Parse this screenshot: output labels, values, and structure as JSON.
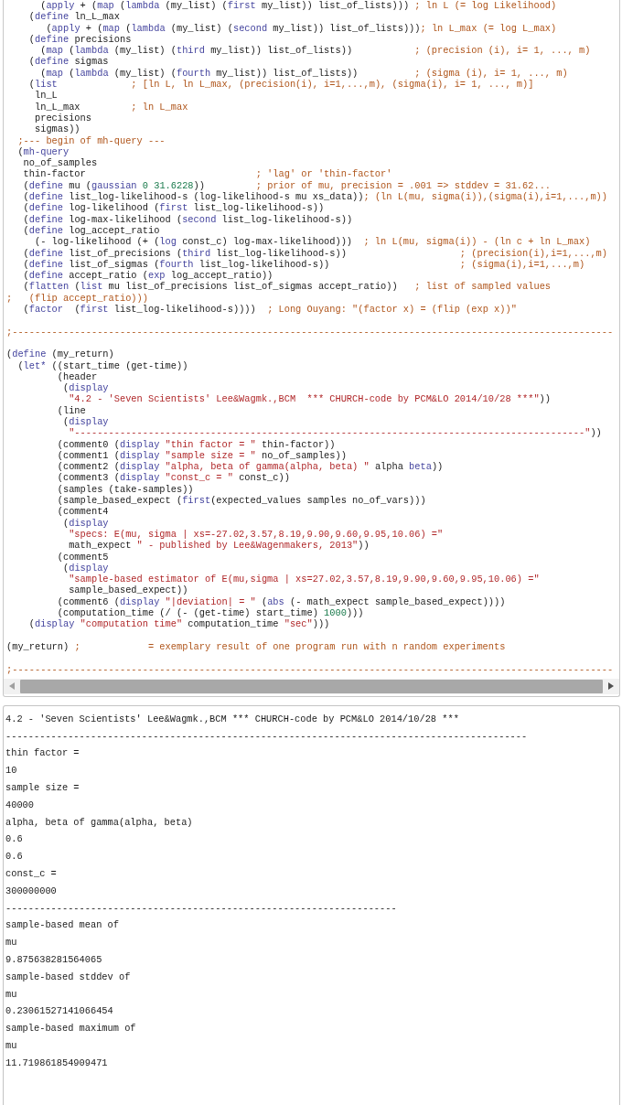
{
  "editor": {
    "lines": [
      {
        "kind": "code",
        "tokens": [
          {
            "kind": "plain",
            "text": "      ("
          },
          {
            "kind": "keyword",
            "text": "apply"
          },
          {
            "kind": "plain",
            "text": " + ("
          },
          {
            "kind": "keyword",
            "text": "map"
          },
          {
            "kind": "plain",
            "text": " ("
          },
          {
            "kind": "keyword",
            "text": "lambda"
          },
          {
            "kind": "plain",
            "text": " (my_list) ("
          },
          {
            "kind": "keyword",
            "text": "first"
          },
          {
            "kind": "plain",
            "text": " my_list)) list_of_lists))) "
          },
          {
            "kind": "comment",
            "text": "; ln L (= log Likelihood)"
          }
        ]
      },
      {
        "kind": "code",
        "tokens": [
          {
            "kind": "plain",
            "text": "    ("
          },
          {
            "kind": "keyword",
            "text": "define"
          },
          {
            "kind": "plain",
            "text": " ln_L_max"
          }
        ]
      },
      {
        "kind": "code",
        "tokens": [
          {
            "kind": "plain",
            "text": "       ("
          },
          {
            "kind": "keyword",
            "text": "apply"
          },
          {
            "kind": "plain",
            "text": " + ("
          },
          {
            "kind": "keyword",
            "text": "map"
          },
          {
            "kind": "plain",
            "text": " ("
          },
          {
            "kind": "keyword",
            "text": "lambda"
          },
          {
            "kind": "plain",
            "text": " (my_list) ("
          },
          {
            "kind": "keyword",
            "text": "second"
          },
          {
            "kind": "plain",
            "text": " my_list)) list_of_lists)))"
          },
          {
            "kind": "comment",
            "text": "; ln L_max (= log L_max)"
          }
        ]
      },
      {
        "kind": "code",
        "tokens": [
          {
            "kind": "plain",
            "text": "    ("
          },
          {
            "kind": "keyword",
            "text": "define"
          },
          {
            "kind": "plain",
            "text": " precisions"
          }
        ]
      },
      {
        "kind": "code",
        "tokens": [
          {
            "kind": "plain",
            "text": "      ("
          },
          {
            "kind": "keyword",
            "text": "map"
          },
          {
            "kind": "plain",
            "text": " ("
          },
          {
            "kind": "keyword",
            "text": "lambda"
          },
          {
            "kind": "plain",
            "text": " (my_list) ("
          },
          {
            "kind": "keyword",
            "text": "third"
          },
          {
            "kind": "plain",
            "text": " my_list)) list_of_lists))           "
          },
          {
            "kind": "comment",
            "text": "; (precision (i), i= 1, ..., m)"
          }
        ]
      },
      {
        "kind": "code",
        "tokens": [
          {
            "kind": "plain",
            "text": "    ("
          },
          {
            "kind": "keyword",
            "text": "define"
          },
          {
            "kind": "plain",
            "text": " sigmas"
          }
        ]
      },
      {
        "kind": "code",
        "tokens": [
          {
            "kind": "plain",
            "text": "      ("
          },
          {
            "kind": "keyword",
            "text": "map"
          },
          {
            "kind": "plain",
            "text": " ("
          },
          {
            "kind": "keyword",
            "text": "lambda"
          },
          {
            "kind": "plain",
            "text": " (my_list) ("
          },
          {
            "kind": "keyword",
            "text": "fourth"
          },
          {
            "kind": "plain",
            "text": " my_list)) list_of_lists))          "
          },
          {
            "kind": "comment",
            "text": "; (sigma (i), i= 1, ..., m)"
          }
        ]
      },
      {
        "kind": "code",
        "tokens": [
          {
            "kind": "plain",
            "text": "    ("
          },
          {
            "kind": "keyword",
            "text": "list"
          },
          {
            "kind": "comment",
            "text": "             ; [ln L, ln L_max, (precision(i), i=1,...,m), (sigma(i), i= 1, ..., m)]"
          }
        ]
      },
      {
        "kind": "code",
        "tokens": [
          {
            "kind": "plain",
            "text": "     ln_L"
          }
        ]
      },
      {
        "kind": "code",
        "tokens": [
          {
            "kind": "plain",
            "text": "     ln_L_max         "
          },
          {
            "kind": "comment",
            "text": "; ln L_max"
          }
        ]
      },
      {
        "kind": "code",
        "tokens": [
          {
            "kind": "plain",
            "text": "     precisions"
          }
        ]
      },
      {
        "kind": "code",
        "tokens": [
          {
            "kind": "plain",
            "text": "     sigmas))"
          }
        ]
      },
      {
        "kind": "code",
        "tokens": [
          {
            "kind": "comment",
            "text": "  ;--- begin of mh-query ---"
          }
        ]
      },
      {
        "kind": "code",
        "tokens": [
          {
            "kind": "plain",
            "text": "  ("
          },
          {
            "kind": "keyword",
            "text": "mh-query"
          }
        ]
      },
      {
        "kind": "code",
        "tokens": [
          {
            "kind": "plain",
            "text": "   no_of_samples"
          }
        ]
      },
      {
        "kind": "code",
        "tokens": [
          {
            "kind": "plain",
            "text": "   thin-factor                              "
          },
          {
            "kind": "comment",
            "text": "; 'lag' or 'thin-factor'"
          }
        ]
      },
      {
        "kind": "code",
        "tokens": [
          {
            "kind": "plain",
            "text": "   ("
          },
          {
            "kind": "keyword",
            "text": "define"
          },
          {
            "kind": "plain",
            "text": " mu ("
          },
          {
            "kind": "keyword",
            "text": "gaussian"
          },
          {
            "kind": "number",
            "text": " 0"
          },
          {
            "kind": "number",
            "text": " 31.6228"
          },
          {
            "kind": "plain",
            "text": "))         "
          },
          {
            "kind": "comment",
            "text": "; prior of mu, precision = .001 => stddev = 31.62..."
          }
        ]
      },
      {
        "kind": "code",
        "tokens": [
          {
            "kind": "plain",
            "text": "   ("
          },
          {
            "kind": "keyword",
            "text": "define"
          },
          {
            "kind": "plain",
            "text": " list_log-likelihood-s (log-likelihood-s mu xs_data))"
          },
          {
            "kind": "comment",
            "text": "; (ln L(mu, sigma(i)),(sigma(i),i=1,...,m))"
          }
        ]
      },
      {
        "kind": "code",
        "tokens": [
          {
            "kind": "plain",
            "text": "   ("
          },
          {
            "kind": "keyword",
            "text": "define"
          },
          {
            "kind": "plain",
            "text": " log-likelihood ("
          },
          {
            "kind": "keyword",
            "text": "first"
          },
          {
            "kind": "plain",
            "text": " list_log-likelihood-s))"
          }
        ]
      },
      {
        "kind": "code",
        "tokens": [
          {
            "kind": "plain",
            "text": "   ("
          },
          {
            "kind": "keyword",
            "text": "define"
          },
          {
            "kind": "plain",
            "text": " log-max-likelihood ("
          },
          {
            "kind": "keyword",
            "text": "second"
          },
          {
            "kind": "plain",
            "text": " list_log-likelihood-s))"
          }
        ]
      },
      {
        "kind": "code",
        "tokens": [
          {
            "kind": "plain",
            "text": "   ("
          },
          {
            "kind": "keyword",
            "text": "define"
          },
          {
            "kind": "plain",
            "text": " log_accept_ratio"
          }
        ]
      },
      {
        "kind": "code",
        "tokens": [
          {
            "kind": "plain",
            "text": "     (- log-likelihood (+ ("
          },
          {
            "kind": "keyword",
            "text": "log"
          },
          {
            "kind": "plain",
            "text": " const_c) log-max-likelihood)))  "
          },
          {
            "kind": "comment",
            "text": "; ln L(mu, sigma(i)) - (ln c + ln L_max)"
          }
        ]
      },
      {
        "kind": "code",
        "tokens": [
          {
            "kind": "plain",
            "text": "   ("
          },
          {
            "kind": "keyword",
            "text": "define"
          },
          {
            "kind": "plain",
            "text": " list_of_precisions ("
          },
          {
            "kind": "keyword",
            "text": "third"
          },
          {
            "kind": "plain",
            "text": " list_log-likelihood-s))                    "
          },
          {
            "kind": "comment",
            "text": "; (precision(i),i=1,...,m)"
          }
        ]
      },
      {
        "kind": "code",
        "tokens": [
          {
            "kind": "plain",
            "text": "   ("
          },
          {
            "kind": "keyword",
            "text": "define"
          },
          {
            "kind": "plain",
            "text": " list_of_sigmas ("
          },
          {
            "kind": "keyword",
            "text": "fourth"
          },
          {
            "kind": "plain",
            "text": " list_log-likelihood-s))                       "
          },
          {
            "kind": "comment",
            "text": "; (sigma(i),i=1,...,m)"
          }
        ]
      },
      {
        "kind": "code",
        "tokens": [
          {
            "kind": "plain",
            "text": "   ("
          },
          {
            "kind": "keyword",
            "text": "define"
          },
          {
            "kind": "plain",
            "text": " accept_ratio ("
          },
          {
            "kind": "keyword",
            "text": "exp"
          },
          {
            "kind": "plain",
            "text": " log_accept_ratio))"
          }
        ]
      },
      {
        "kind": "code",
        "tokens": [
          {
            "kind": "plain",
            "text": "   ("
          },
          {
            "kind": "keyword",
            "text": "flatten"
          },
          {
            "kind": "plain",
            "text": " ("
          },
          {
            "kind": "keyword",
            "text": "list"
          },
          {
            "kind": "plain",
            "text": " mu list_of_precisions list_of_sigmas accept_ratio))   "
          },
          {
            "kind": "comment",
            "text": "; list of sampled values"
          }
        ]
      },
      {
        "kind": "code",
        "tokens": [
          {
            "kind": "comment",
            "text": ";   (flip accept_ratio)))"
          }
        ]
      },
      {
        "kind": "code",
        "tokens": [
          {
            "kind": "plain",
            "text": "   ("
          },
          {
            "kind": "keyword",
            "text": "factor"
          },
          {
            "kind": "plain",
            "text": "  ("
          },
          {
            "kind": "keyword",
            "text": "first"
          },
          {
            "kind": "plain",
            "text": " list_log-likelihood-s))))  "
          },
          {
            "kind": "comment",
            "text": "; Long Ouyang: \"(factor x) = (flip (exp x))\""
          }
        ]
      },
      {
        "kind": "blank"
      },
      {
        "kind": "code",
        "tokens": [
          {
            "kind": "comment",
            "text": ";----------------------------------------------------------------------------------------------------------"
          }
        ]
      },
      {
        "kind": "blank"
      },
      {
        "kind": "code",
        "tokens": [
          {
            "kind": "plain",
            "text": "("
          },
          {
            "kind": "keyword",
            "text": "define"
          },
          {
            "kind": "plain",
            "text": " (my_return)"
          }
        ]
      },
      {
        "kind": "code",
        "tokens": [
          {
            "kind": "plain",
            "text": "  ("
          },
          {
            "kind": "keyword",
            "text": "let*"
          },
          {
            "kind": "plain",
            "text": " ((start_time (get-time))"
          }
        ]
      },
      {
        "kind": "code",
        "tokens": [
          {
            "kind": "plain",
            "text": "         (header"
          }
        ]
      },
      {
        "kind": "code",
        "tokens": [
          {
            "kind": "plain",
            "text": "          ("
          },
          {
            "kind": "keyword",
            "text": "display"
          }
        ]
      },
      {
        "kind": "code",
        "tokens": [
          {
            "kind": "string",
            "text": "           \"4.2 - 'Seven Scientists' Lee&Wagmk.,BCM  *** CHURCH-code by PCM&LO 2014/10/28 ***\""
          },
          {
            "kind": "plain",
            "text": "))"
          }
        ]
      },
      {
        "kind": "code",
        "tokens": [
          {
            "kind": "plain",
            "text": "         (line"
          }
        ]
      },
      {
        "kind": "code",
        "tokens": [
          {
            "kind": "plain",
            "text": "          ("
          },
          {
            "kind": "keyword",
            "text": "display"
          }
        ]
      },
      {
        "kind": "code",
        "tokens": [
          {
            "kind": "string",
            "text": "           \"------------------------------------------------------------------------------------------\""
          },
          {
            "kind": "plain",
            "text": "))"
          }
        ]
      },
      {
        "kind": "code",
        "tokens": [
          {
            "kind": "plain",
            "text": "         (comment0 ("
          },
          {
            "kind": "keyword",
            "text": "display"
          },
          {
            "kind": "string",
            "text": " \"thin factor = \""
          },
          {
            "kind": "plain",
            "text": " thin-factor))"
          }
        ]
      },
      {
        "kind": "code",
        "tokens": [
          {
            "kind": "plain",
            "text": "         (comment1 ("
          },
          {
            "kind": "keyword",
            "text": "display"
          },
          {
            "kind": "string",
            "text": " \"sample size = \""
          },
          {
            "kind": "plain",
            "text": " no_of_samples))"
          }
        ]
      },
      {
        "kind": "code",
        "tokens": [
          {
            "kind": "plain",
            "text": "         (comment2 ("
          },
          {
            "kind": "keyword",
            "text": "display"
          },
          {
            "kind": "string",
            "text": " \"alpha, beta of gamma(alpha, beta) \""
          },
          {
            "kind": "plain",
            "text": " alpha "
          },
          {
            "kind": "keyword",
            "text": "beta"
          },
          {
            "kind": "plain",
            "text": "))"
          }
        ]
      },
      {
        "kind": "code",
        "tokens": [
          {
            "kind": "plain",
            "text": "         (comment3 ("
          },
          {
            "kind": "keyword",
            "text": "display"
          },
          {
            "kind": "string",
            "text": " \"const_c = \""
          },
          {
            "kind": "plain",
            "text": " const_c))"
          }
        ]
      },
      {
        "kind": "code",
        "tokens": [
          {
            "kind": "plain",
            "text": "         (samples (take-samples))"
          }
        ]
      },
      {
        "kind": "code",
        "tokens": [
          {
            "kind": "plain",
            "text": "         (sample_based_expect ("
          },
          {
            "kind": "keyword",
            "text": "first"
          },
          {
            "kind": "plain",
            "text": "(expected_values samples no_of_vars)))"
          }
        ]
      },
      {
        "kind": "code",
        "tokens": [
          {
            "kind": "plain",
            "text": "         (comment4"
          }
        ]
      },
      {
        "kind": "code",
        "tokens": [
          {
            "kind": "plain",
            "text": "          ("
          },
          {
            "kind": "keyword",
            "text": "display"
          }
        ]
      },
      {
        "kind": "code",
        "tokens": [
          {
            "kind": "string",
            "text": "           \"specs: E(mu, sigma | xs=-27.02,3.57,8.19,9.90,9.60,9.95,10.06) =\""
          }
        ]
      },
      {
        "kind": "code",
        "tokens": [
          {
            "kind": "plain",
            "text": "           math_expect "
          },
          {
            "kind": "string",
            "text": "\" - published by Lee&Wagenmakers, 2013\""
          },
          {
            "kind": "plain",
            "text": "))"
          }
        ]
      },
      {
        "kind": "code",
        "tokens": [
          {
            "kind": "plain",
            "text": "         (comment5"
          }
        ]
      },
      {
        "kind": "code",
        "tokens": [
          {
            "kind": "plain",
            "text": "          ("
          },
          {
            "kind": "keyword",
            "text": "display"
          }
        ]
      },
      {
        "kind": "code",
        "tokens": [
          {
            "kind": "string",
            "text": "           \"sample-based estimator of E(mu,sigma | xs=27.02,3.57,8.19,9.90,9.60,9.95,10.06) =\""
          }
        ]
      },
      {
        "kind": "code",
        "tokens": [
          {
            "kind": "plain",
            "text": "           sample_based_expect))"
          }
        ]
      },
      {
        "kind": "code",
        "tokens": [
          {
            "kind": "plain",
            "text": "         (comment6 ("
          },
          {
            "kind": "keyword",
            "text": "display"
          },
          {
            "kind": "string",
            "text": " \"|deviation| = \""
          },
          {
            "kind": "plain",
            "text": " ("
          },
          {
            "kind": "keyword",
            "text": "abs"
          },
          {
            "kind": "plain",
            "text": " (- math_expect sample_based_expect))))"
          }
        ]
      },
      {
        "kind": "code",
        "tokens": [
          {
            "kind": "plain",
            "text": "         (computation_time (/ (- (get-time) start_time) "
          },
          {
            "kind": "number",
            "text": "1000"
          },
          {
            "kind": "plain",
            "text": ")))"
          }
        ]
      },
      {
        "kind": "code",
        "tokens": [
          {
            "kind": "plain",
            "text": "    ("
          },
          {
            "kind": "keyword",
            "text": "display"
          },
          {
            "kind": "string",
            "text": " \"computation time\""
          },
          {
            "kind": "plain",
            "text": " computation_time "
          },
          {
            "kind": "string",
            "text": "\"sec\""
          },
          {
            "kind": "plain",
            "text": ")))"
          }
        ]
      },
      {
        "kind": "blank"
      },
      {
        "kind": "code",
        "tokens": [
          {
            "kind": "plain",
            "text": "(my_return) "
          },
          {
            "kind": "comment",
            "text": ";            = exemplary result of one program run with n random experiments"
          }
        ]
      },
      {
        "kind": "blank"
      },
      {
        "kind": "code",
        "tokens": [
          {
            "kind": "comment",
            "text": ";----------------------------------------------------------------------------------------------------------"
          }
        ]
      }
    ]
  },
  "output": {
    "lines": [
      "4.2 - 'Seven Scientists' Lee&Wagmk.,BCM *** CHURCH-code by PCM&LO 2014/10/28 ***",
      "--------------------------------------------------------------------------------------------",
      "thin factor =",
      "10",
      "sample size =",
      "40000",
      "alpha, beta of gamma(alpha, beta)",
      "0.6",
      "0.6",
      "const_c =",
      "300000000",
      "---------------------------------------------------------------------",
      "sample-based mean of",
      "mu",
      "9.875638281564065",
      "sample-based stddev of",
      "mu",
      "0.23061527141066454",
      "sample-based maximum of",
      "mu",
      "11.719861854909471"
    ]
  }
}
